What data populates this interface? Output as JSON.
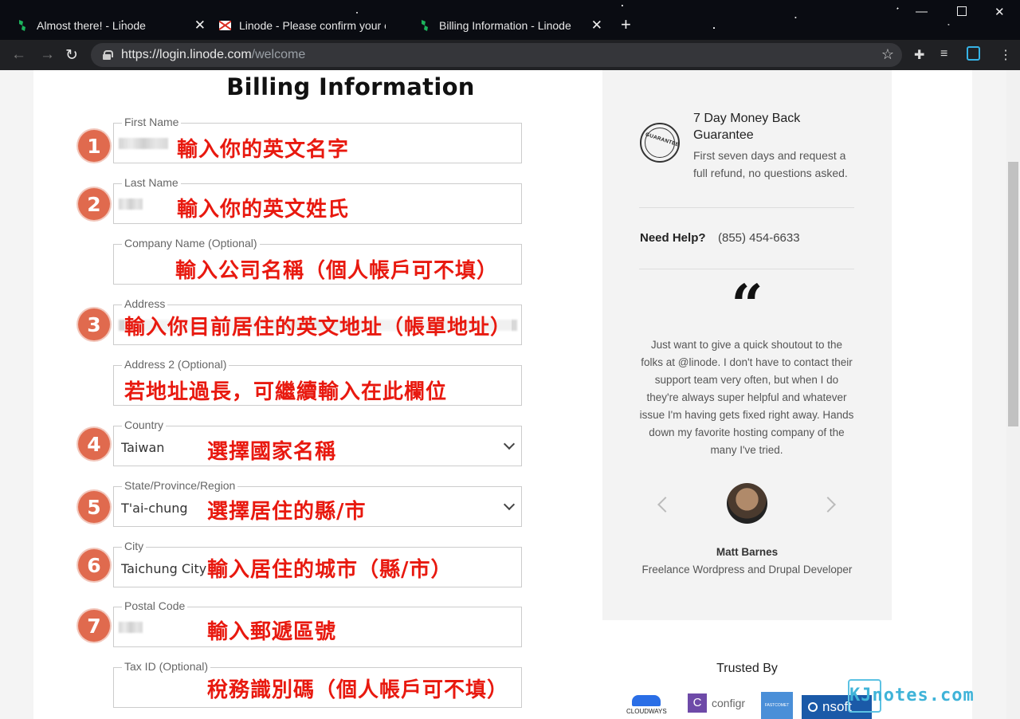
{
  "browser": {
    "tabs": [
      {
        "title": "Almost there! - Linode"
      },
      {
        "title": "Linode - Please confirm your e"
      },
      {
        "title": "Billing Information - Linode"
      }
    ],
    "url_host": "https://login.linode.com",
    "url_path": "/welcome"
  },
  "form": {
    "title": "Billing Information",
    "fields": [
      {
        "label": "First Name",
        "value": "",
        "annotation": "輸入你的英文名字",
        "step": "1"
      },
      {
        "label": "Last Name",
        "value": "",
        "annotation": "輸入你的英文姓氏",
        "step": "2"
      },
      {
        "label": "Company Name (Optional)",
        "value": "",
        "annotation": "輸入公司名稱（個人帳戶可不填）",
        "step": ""
      },
      {
        "label": "Address",
        "value": "",
        "annotation": "輸入你目前居住的英文地址（帳單地址）",
        "step": "3"
      },
      {
        "label": "Address 2 (Optional)",
        "value": "",
        "annotation": "若地址過長，可繼續輸入在此欄位",
        "step": ""
      },
      {
        "label": "Country",
        "value": "Taiwan",
        "annotation": "選擇國家名稱",
        "step": "4"
      },
      {
        "label": "State/Province/Region",
        "value": "T'ai-chung",
        "annotation": "選擇居住的縣/市",
        "step": "5"
      },
      {
        "label": "City",
        "value": "Taichung City",
        "annotation": "輸入居住的城市（縣/市）",
        "step": "6"
      },
      {
        "label": "Postal Code",
        "value": "",
        "annotation": "輸入郵遞區號",
        "step": "7"
      },
      {
        "label": "Tax ID (Optional)",
        "value": "",
        "annotation": "稅務識別碼（個人帳戶可不填）",
        "step": ""
      }
    ]
  },
  "sidebar": {
    "seal_text": "GUARANTEE",
    "guarantee_title": "7 Day Money Back Guarantee",
    "guarantee_text": "First seven days and request a full refund, no questions asked.",
    "help_label": "Need Help?",
    "help_phone": "(855) 454-6633",
    "quote_mark": "“",
    "quote": "Just want to give a quick shoutout to the folks at @linode. I don't have to contact their support team very often, but when I do they're always super helpful and whatever issue I'm having gets fixed right away. Hands down my favorite hosting company of the many I've tried.",
    "author": "Matt Barnes",
    "author_role": "Freelance Wordpress and Drupal Developer",
    "trusted_by": "Trusted By",
    "logos": [
      "CLOUDWAYS",
      "configr",
      "FASTCOMET",
      "nsoft"
    ]
  },
  "watermark": "KJnotes.com"
}
